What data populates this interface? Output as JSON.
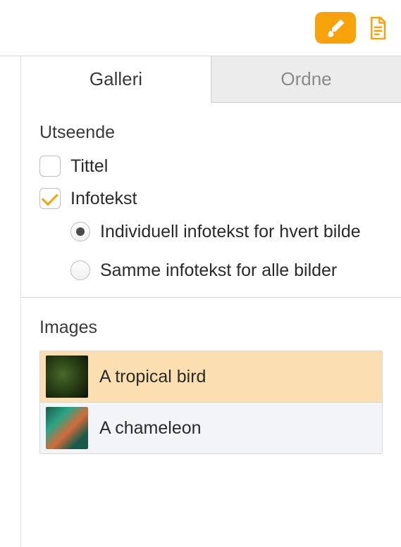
{
  "toolbar": {
    "format_icon": "brush",
    "document_icon": "document"
  },
  "tabs": {
    "gallery": "Galleri",
    "arrange": "Ordne"
  },
  "appearance": {
    "title": "Utseende",
    "title_checkbox": {
      "label": "Tittel",
      "checked": false
    },
    "caption_checkbox": {
      "label": "Infotekst",
      "checked": true
    },
    "caption_mode": {
      "individual": {
        "label": "Individuell infotekst for hvert bilde",
        "selected": true
      },
      "same": {
        "label": "Samme infotekst for alle bilder",
        "selected": false
      }
    }
  },
  "images": {
    "title": "Images",
    "items": [
      {
        "label": "A tropical bird",
        "selected": true,
        "thumb_class": "bird"
      },
      {
        "label": "A chameleon",
        "selected": false,
        "thumb_class": "chameleon"
      }
    ]
  }
}
